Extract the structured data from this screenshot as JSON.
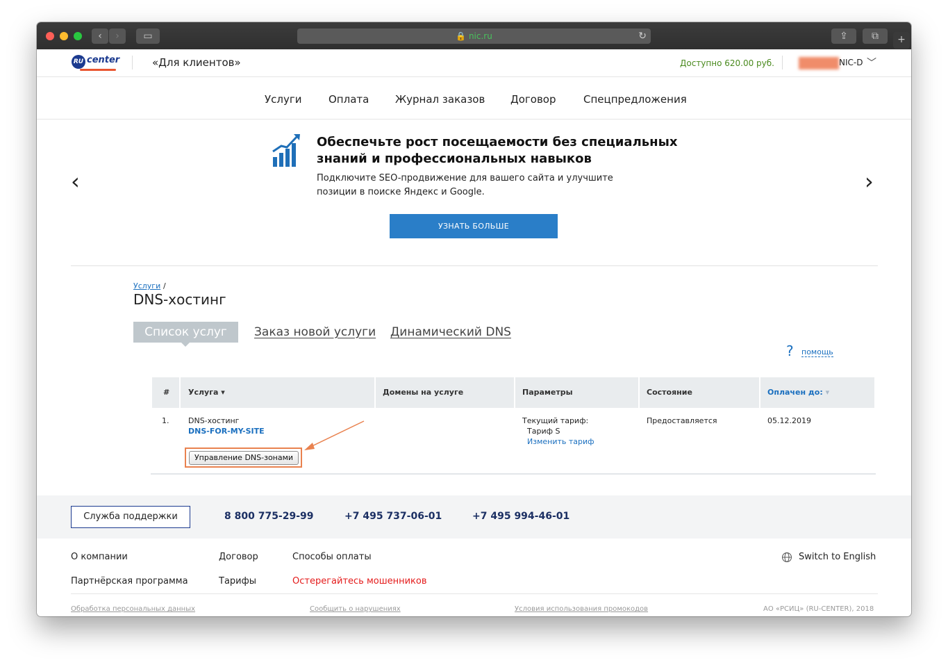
{
  "browser": {
    "url": "nic.ru",
    "reload_icon": "reload-icon",
    "lights": [
      "#fe5f57",
      "#febc2e",
      "#29c840"
    ]
  },
  "header": {
    "logo_ru": "RU",
    "logo_center": "center",
    "title": "«Для клиентов»",
    "balance": "Доступно 620.00 руб.",
    "account": "NIC-D"
  },
  "nav": [
    "Услуги",
    "Оплата",
    "Журнал заказов",
    "Договор",
    "Спецпредложения"
  ],
  "promo": {
    "title": "Обеспечьте рост посещаемости без специальных знаний и профессиональных навыков",
    "text": "Подключите SEO-продвижение для вашего сайта и улучшите позиции в поиске Яндекс и Google.",
    "button": "УЗНАТЬ БОЛЬШЕ"
  },
  "breadcrumb": {
    "link": "Услуги",
    "sep": "/"
  },
  "page_title": "DNS-хостинг",
  "tabs": [
    "Список услуг",
    "Заказ новой услуги",
    "Динамический DNS"
  ],
  "help": {
    "q": "?",
    "label": "помощь"
  },
  "table": {
    "headers": [
      "#",
      "Услуга ▾",
      "Домены на услуге",
      "Параметры",
      "Состояние",
      "Оплачен до:"
    ],
    "row": {
      "num": "1.",
      "service": "DNS-хостинг",
      "service_name": "DNS-FOR-MY-SITE",
      "params_label": "Текущий тариф:",
      "tariff": "Тариф S",
      "change_tariff": "Изменить тариф",
      "status": "Предоставляется",
      "paid_until": "05.12.2019",
      "dns_button": "Управление DNS-зонами"
    }
  },
  "footer": {
    "support": "Служба поддержки",
    "phones": [
      "8 800 775-29-99",
      "+7 495 737-06-01",
      "+7 495 994-46-01"
    ],
    "links": [
      "О компании",
      "Договор",
      "Способы оплаты",
      "Партнёрская программа",
      "Тарифы",
      "Остерегайтесь мошенников"
    ],
    "switch_lang": "Switch to English",
    "small_links": [
      "Обработка персональных данных",
      "Сообщить о нарушениях",
      "Условия использования промокодов"
    ],
    "copyright": "АО «РСИЦ» (RU-CENTER), 2018"
  }
}
